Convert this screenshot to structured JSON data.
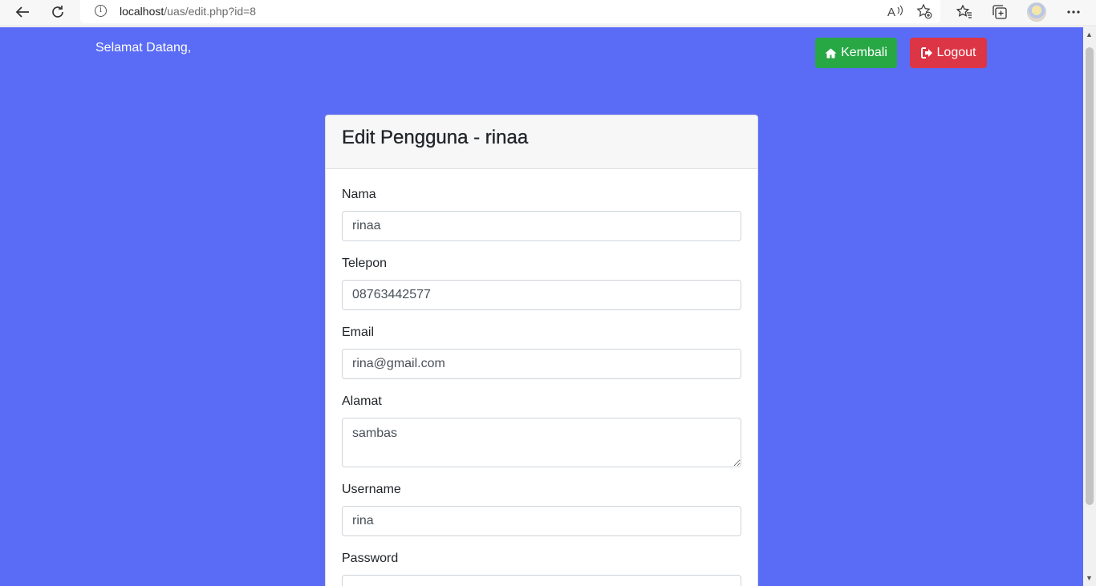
{
  "browser": {
    "url_host": "localhost",
    "url_path": "/uas/edit.php?id=8",
    "icons": [
      "back-arrow-icon",
      "refresh-icon",
      "info-icon",
      "read-aloud-icon",
      "add-favorite-icon",
      "favorites-icon",
      "collections-icon",
      "profile-avatar",
      "more-menu-icon"
    ]
  },
  "header": {
    "welcome": "Selamat Datang,",
    "kembali_label": "Kembali",
    "logout_label": "Logout",
    "colors": {
      "page_bg": "#5a6cf5",
      "success": "#28a745",
      "danger": "#dc3545"
    }
  },
  "card": {
    "title": "Edit Pengguna - rinaa",
    "fields": {
      "nama": {
        "label": "Nama",
        "value": "rinaa"
      },
      "telepon": {
        "label": "Telepon",
        "value": "08763442577"
      },
      "email": {
        "label": "Email",
        "value": "rina@gmail.com"
      },
      "alamat": {
        "label": "Alamat",
        "value": "sambas"
      },
      "username": {
        "label": "Username",
        "value": "rina"
      },
      "password": {
        "label": "Password",
        "value": ""
      }
    }
  }
}
